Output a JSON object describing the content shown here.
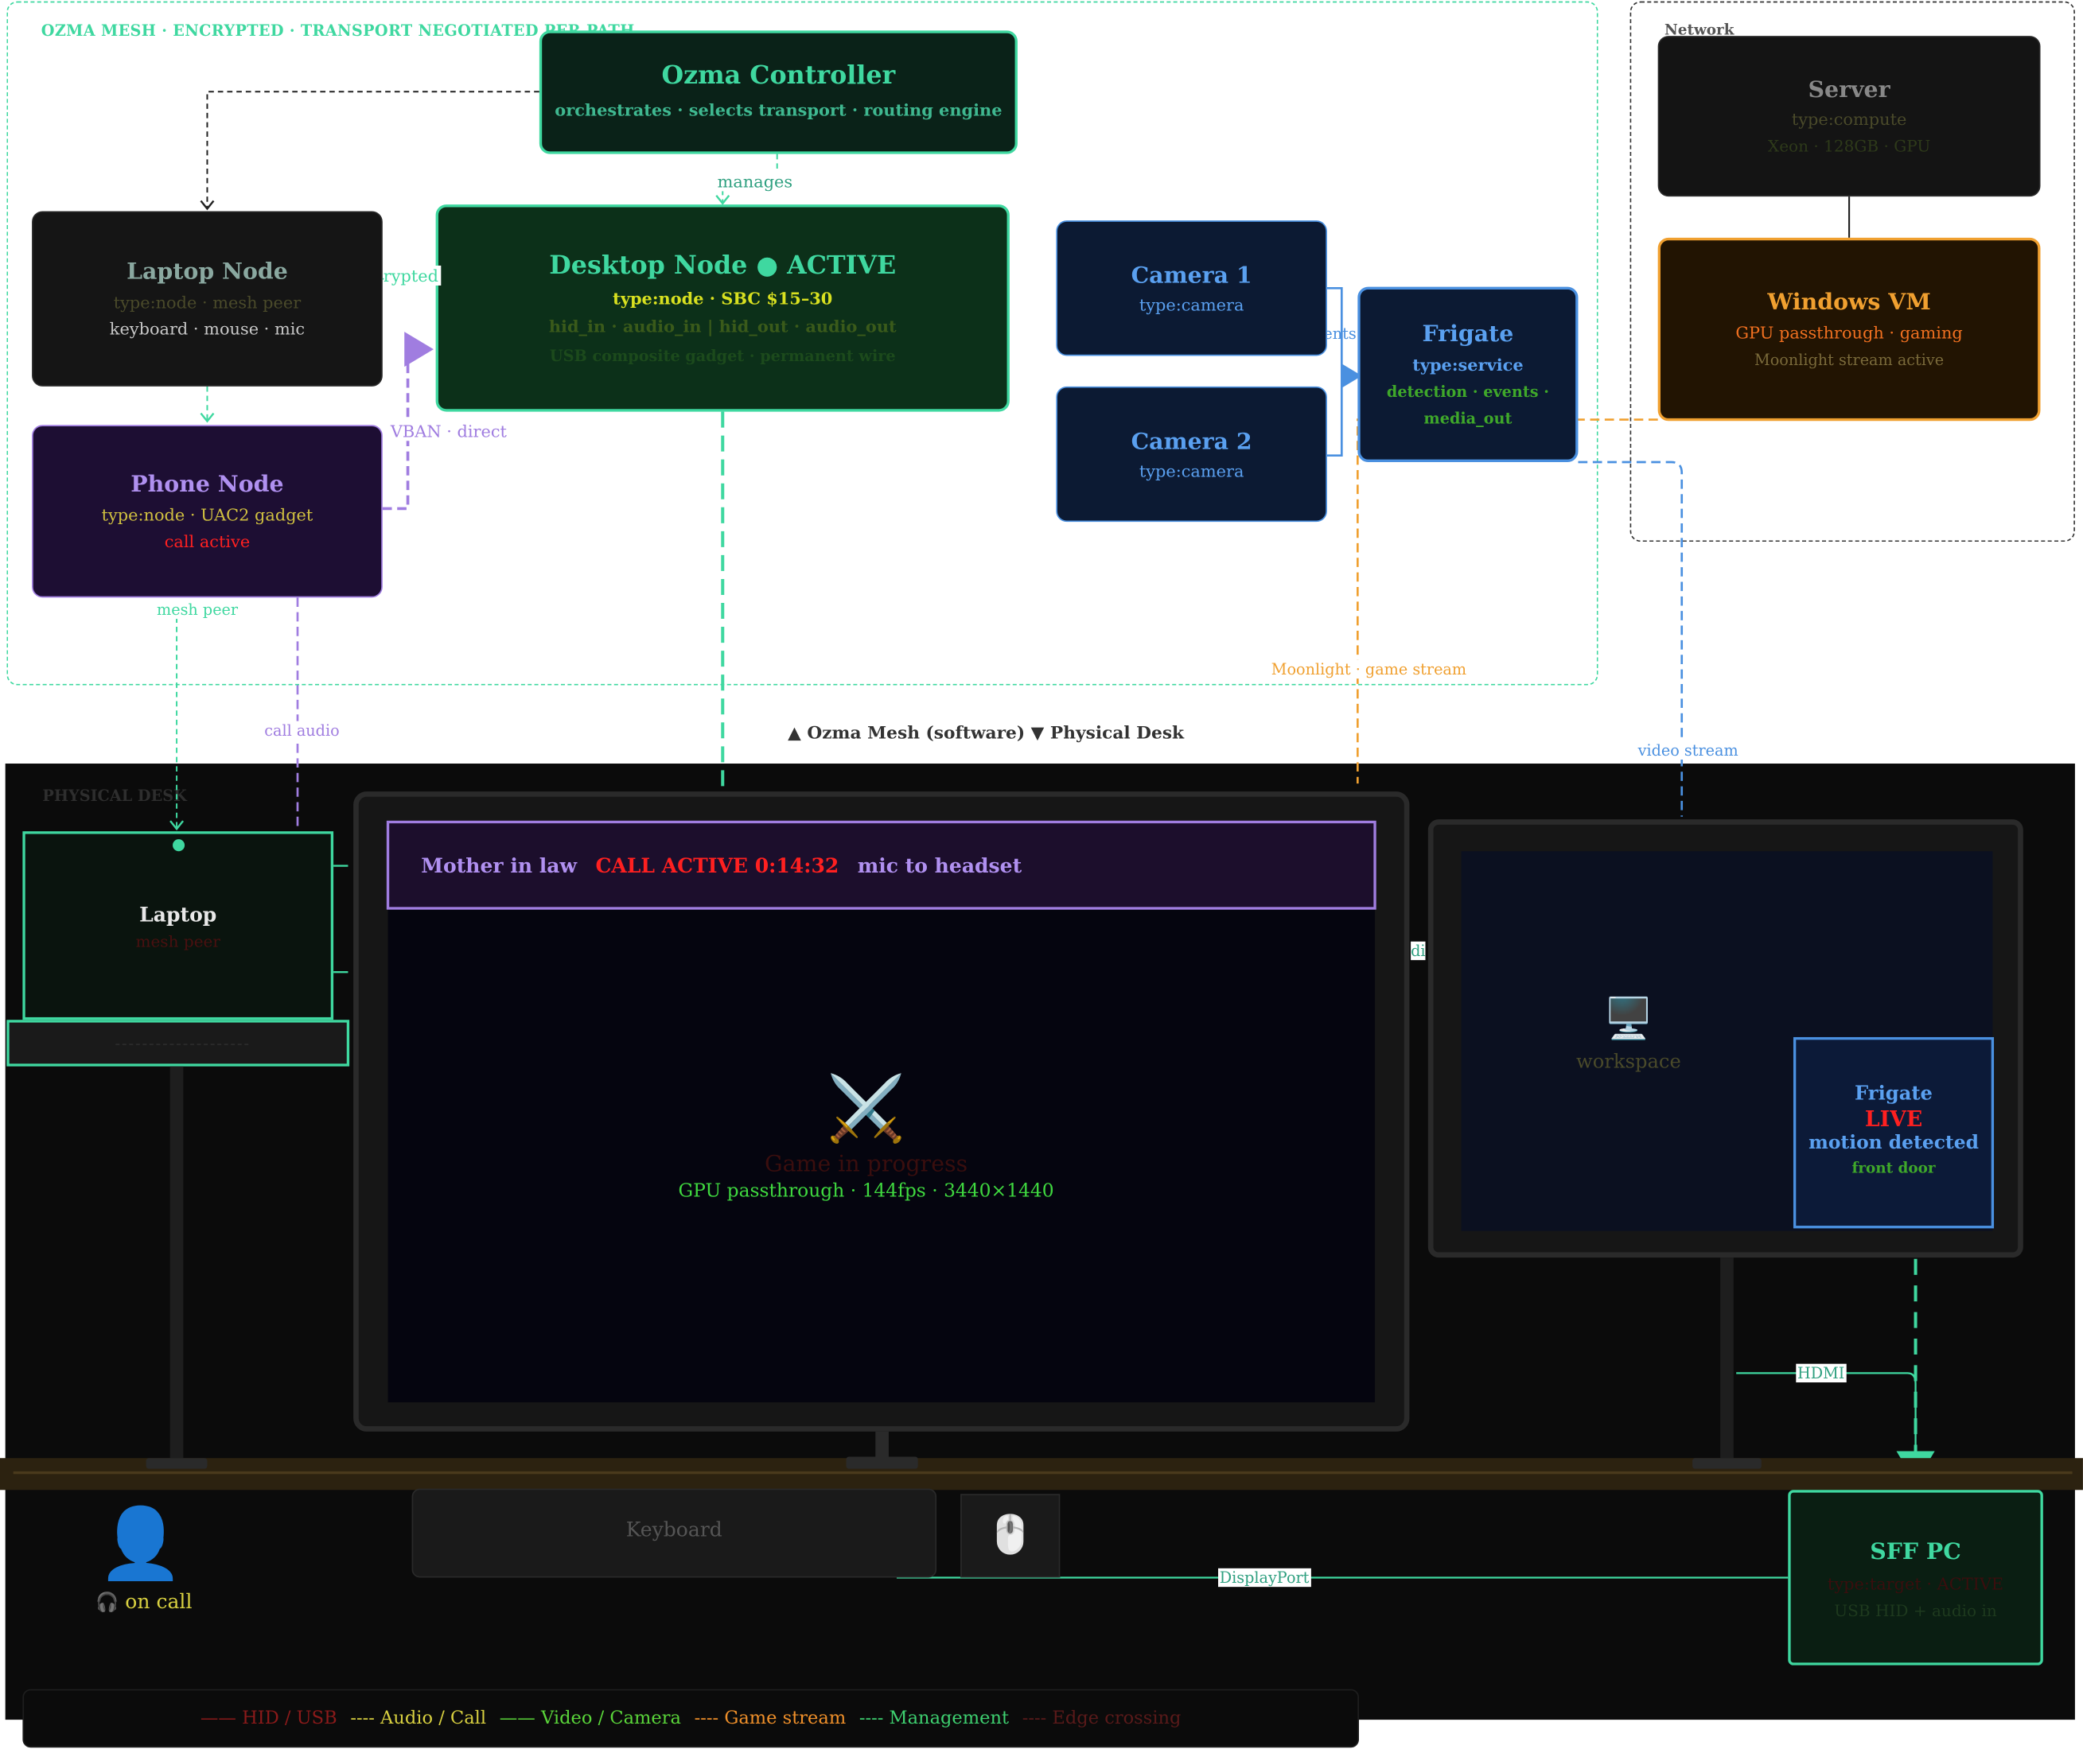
{
  "mesh_zone": {
    "label": "OZMA MESH · ENCRYPTED · TRANSPORT NEGOTIATED PER PATH"
  },
  "network_zone": {
    "label": "Network"
  },
  "controller": {
    "title": "Ozma Controller",
    "subtitle": "orchestrates · selects transport · routing engine"
  },
  "laptop_node": {
    "title": "Laptop Node",
    "type": "type:node · mesh peer",
    "io": "keyboard · mouse · mic"
  },
  "phone_node": {
    "title": "Phone Node",
    "type": "type:node · UAC2 gadget",
    "status": "call active"
  },
  "desktop_node": {
    "title": "Desktop Node ● ACTIVE",
    "type": "type:node · SBC $15–30",
    "io": "hid_in · audio_in | hid_out · audio_out",
    "note": "USB composite gadget · permanent wire"
  },
  "camera1": {
    "title": "Camera 1",
    "type": "type:camera"
  },
  "camera2": {
    "title": "Camera 2",
    "type": "type:camera"
  },
  "frigate_node": {
    "title": "Frigate",
    "type": "type:service",
    "line1": "detection · events ·",
    "line2": "media_out"
  },
  "server": {
    "title": "Server",
    "type": "type:compute",
    "spec": "Xeon · 128GB · GPU"
  },
  "windows_vm": {
    "title": "Windows VM",
    "line1": "GPU passthrough · gaming",
    "line2": "Moonlight stream active"
  },
  "edge_labels": {
    "manages": "manages",
    "encrypted": "encrypted",
    "vban": "VBAN · direct",
    "mesh_peer": "mesh peer",
    "call_audio": "call audio",
    "rtsp": "rtsp · events",
    "moonlight": "Moonlight · game stream",
    "video_stream": "video stream",
    "divider": "▲ Ozma Mesh (software) ▼ Physical Desk",
    "displayport": "DisplayPort",
    "hdmi": "HDMI",
    "di": "di"
  },
  "desk_zone": {
    "label": "PHYSICAL DESK"
  },
  "laptop_device": {
    "title": "Laptop",
    "subtitle": "mesh peer"
  },
  "main_monitor": {
    "banner_name": "Mother in law",
    "banner_status": "CALL ACTIVE 0:14:32",
    "banner_route": "mic to headset",
    "game_icon": "⚔️",
    "game_title": "Game in progress",
    "game_info": "GPU passthrough · 144fps · 3440×1440"
  },
  "side_monitor": {
    "workspace_icon": "🖥️",
    "workspace_label": "workspace",
    "frigate_title": "Frigate",
    "frigate_live": "LIVE",
    "frigate_motion": "motion detected",
    "frigate_location": "front door"
  },
  "keyboard": {
    "label": "Keyboard"
  },
  "mouse": {
    "icon": "🖱️"
  },
  "person": {
    "icon": "👤",
    "headset_icon": "🎧",
    "status": "on call"
  },
  "sff_pc": {
    "title": "SFF PC",
    "type": "type:target · ACTIVE",
    "io": "USB HID + audio in"
  },
  "legend": [
    {
      "marker": "——",
      "label": "HID / USB",
      "color": "#8b1a1a"
    },
    {
      "marker": "----",
      "label": "Audio / Call",
      "color": "#d8d040"
    },
    {
      "marker": "——",
      "label": "Video / Camera",
      "color": "#5ad63a"
    },
    {
      "marker": "----",
      "label": "Game stream",
      "color": "#f0902a"
    },
    {
      "marker": "----",
      "label": "Management",
      "color": "#3ed070"
    },
    {
      "marker": "----",
      "label": "Edge crossing",
      "color": "#5a1a1a"
    }
  ],
  "colors": {
    "mesh_green": "#3fd8a0",
    "phone_purple": "#a07de0",
    "camera_blue": "#4a90e0",
    "vm_orange": "#f0a030",
    "alert_red": "#ff2020"
  }
}
